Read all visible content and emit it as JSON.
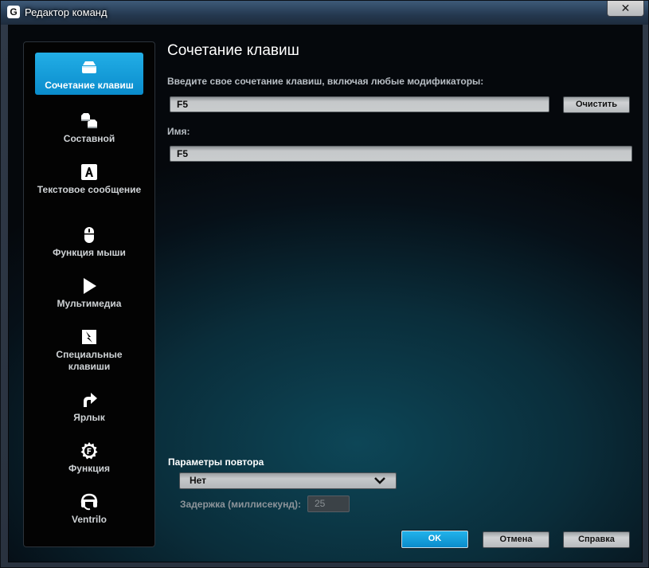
{
  "window": {
    "title": "Редактор команд",
    "app_icon_letter": "G",
    "close_glyph": "✕"
  },
  "sidebar": {
    "items": [
      {
        "label": "Сочетание клавиш",
        "icon": "keystroke-icon",
        "active": true
      },
      {
        "label": "Составной",
        "icon": "multikey-icon",
        "active": false
      },
      {
        "label": "Текстовое сообщение",
        "icon": "text-block-icon",
        "active": false
      },
      {
        "label": "Функция мыши",
        "icon": "mouse-icon",
        "active": false
      },
      {
        "label": "Мультимедиа",
        "icon": "play-icon",
        "active": false
      },
      {
        "label": "Специальные клавиши",
        "icon": "hotkey-icon",
        "active": false
      },
      {
        "label": "Ярлык",
        "icon": "shortcut-arrow-icon",
        "active": false
      },
      {
        "label": "Функция",
        "icon": "function-gear-icon",
        "active": false
      },
      {
        "label": "Ventrilo",
        "icon": "headset-icon",
        "active": false
      }
    ]
  },
  "main": {
    "heading": "Сочетание клавиш",
    "keystroke_label": "Введите свое сочетание клавиш, включая любые модификаторы:",
    "keystroke_value": "F5",
    "clear_button": "Очистить",
    "name_label": "Имя:",
    "name_value": "F5"
  },
  "repeat": {
    "title": "Параметры повтора",
    "selected": "Нет",
    "delay_label": "Задержка (миллисекунд):",
    "delay_value": "25"
  },
  "footer": {
    "ok": "OK",
    "cancel": "Отмена",
    "help": "Справка"
  },
  "colors": {
    "accent": "#1aa0dc",
    "sidebar_bg": "#030303",
    "panel_glow": "#0d4657"
  }
}
